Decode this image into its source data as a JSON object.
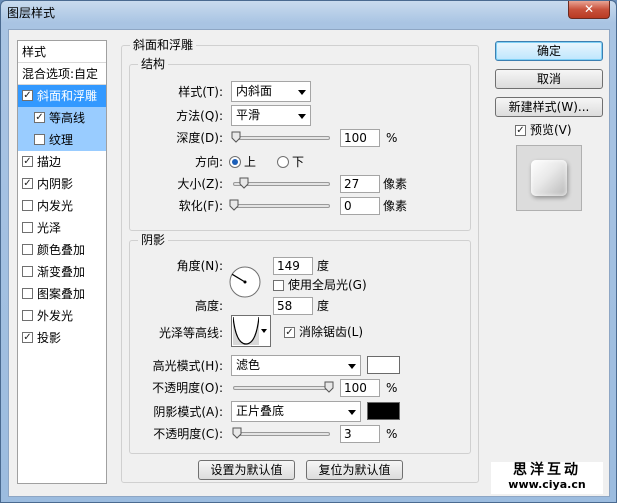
{
  "window": {
    "title": "图层样式",
    "close_glyph": "✕"
  },
  "sidebar": {
    "header": "样式",
    "blend_options": "混合选项:自定",
    "items": [
      {
        "label": "斜面和浮雕",
        "checked": true,
        "state": "selected"
      },
      {
        "label": "等高线",
        "checked": true,
        "state": "sub"
      },
      {
        "label": "纹理",
        "checked": false,
        "state": "sub"
      },
      {
        "label": "描边",
        "checked": true
      },
      {
        "label": "内阴影",
        "checked": true
      },
      {
        "label": "内发光",
        "checked": false
      },
      {
        "label": "光泽",
        "checked": false
      },
      {
        "label": "颜色叠加",
        "checked": false
      },
      {
        "label": "渐变叠加",
        "checked": false
      },
      {
        "label": "图案叠加",
        "checked": false
      },
      {
        "label": "外发光",
        "checked": false
      },
      {
        "label": "投影",
        "checked": true
      }
    ]
  },
  "bevel": {
    "title": "斜面和浮雕",
    "structure": {
      "title": "结构",
      "style_label": "样式(T):",
      "style_value": "内斜面",
      "method_label": "方法(Q):",
      "method_value": "平滑",
      "depth_label": "深度(D):",
      "depth_value": "100",
      "depth_unit": "%",
      "depth_pct": 2,
      "direction_label": "方向:",
      "direction_up": "上",
      "direction_down": "下",
      "size_label": "大小(Z):",
      "size_value": "27",
      "size_unit": "像素",
      "size_pct": 11,
      "soften_label": "软化(F):",
      "soften_value": "0",
      "soften_unit": "像素",
      "soften_pct": 0
    },
    "shading": {
      "title": "阴影",
      "angle_label": "角度(N):",
      "angle_value": "149",
      "angle_unit": "度",
      "global_light_label": "使用全局光(G)",
      "global_light_checked": false,
      "altitude_label": "高度:",
      "altitude_value": "58",
      "altitude_unit": "度",
      "gloss_label": "光泽等高线:",
      "antialias_label": "消除锯齿(L)",
      "antialias_checked": true,
      "highlight_label": "高光模式(H):",
      "highlight_value": "滤色",
      "highlight_color": "#ffffff",
      "highlight_opacity_label": "不透明度(O):",
      "highlight_opacity_value": "100",
      "highlight_opacity_unit": "%",
      "highlight_opacity_pct": 100,
      "shadow_label": "阴影模式(A):",
      "shadow_value": "正片叠底",
      "shadow_color": "#000000",
      "shadow_opacity_label": "不透明度(C):",
      "shadow_opacity_value": "3",
      "shadow_opacity_unit": "%",
      "shadow_opacity_pct": 3
    },
    "make_default": "设置为默认值",
    "reset_default": "复位为默认值"
  },
  "actions": {
    "ok": "确定",
    "cancel": "取消",
    "new_style": "新建样式(W)...",
    "preview_label": "预览(V)",
    "preview_checked": true
  },
  "watermark": {
    "line1": "思洋互动",
    "line2": "www.ciya.cn"
  }
}
